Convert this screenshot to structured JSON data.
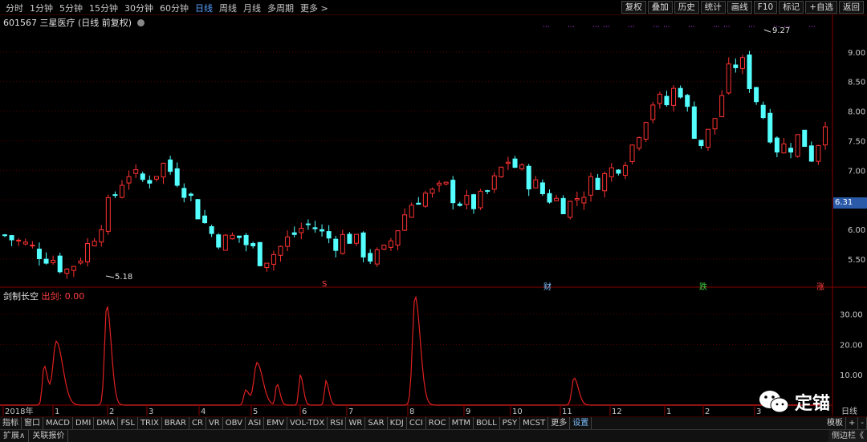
{
  "toolbar": {
    "periods": [
      "分时",
      "1分钟",
      "5分钟",
      "15分钟",
      "30分钟",
      "60分钟",
      "日线",
      "周线",
      "月线",
      "多周期",
      "更多 >"
    ],
    "active_period": "日线",
    "right_buttons": [
      "复权",
      "叠加",
      "历史",
      "统计",
      "画线",
      "F10",
      "标记",
      "+自选",
      "返回"
    ]
  },
  "stock": {
    "code_name": "601567 三星医疗 (日线 前复权)"
  },
  "price_axis": {
    "ticks": [
      "9.00",
      "8.50",
      "8.00",
      "7.50",
      "7.00",
      "6.50",
      "6.00",
      "5.50"
    ],
    "current": "6.31"
  },
  "annotations": {
    "high": "9.27",
    "low": "5.18"
  },
  "events": [
    "S",
    "财",
    "跌",
    "涨"
  ],
  "indicator": {
    "name": "剑制长空",
    "label": "出剑: 0.00",
    "ticks": [
      "30.00",
      "20.00",
      "10.00"
    ]
  },
  "time_axis": [
    "2018年",
    "1",
    "2",
    "3",
    "4",
    "5",
    "6",
    "7",
    "8",
    "9",
    "10",
    "11",
    "12",
    "1",
    "2",
    "3"
  ],
  "panel_label": "日线",
  "bottom_tabs": [
    "指标",
    "窗口",
    "MACD",
    "DMI",
    "DMA",
    "FSL",
    "TRIX",
    "BRAR",
    "CR",
    "VR",
    "OBV",
    "ASI",
    "EMV",
    "VOL-TDX",
    "RSI",
    "WR",
    "SAR",
    "KDJ",
    "CCI",
    "ROC",
    "MTM",
    "BOLL",
    "PSY",
    "MCST",
    "更多",
    "设置"
  ],
  "bottom_right": [
    "模板",
    "+",
    "-"
  ],
  "status_bar": {
    "left": [
      "扩展∧",
      "关联报价"
    ],
    "right": "侧边栏《"
  },
  "watermark": "定锚",
  "colors": {
    "up": "#ff3232",
    "down": "#54ffff",
    "grid": "#5a0000",
    "accent": "#5aa0ff"
  },
  "chart_data": {
    "type": "candlestick",
    "price_range": [
      5.18,
      9.27
    ],
    "closes": [
      5.9,
      5.8,
      5.7,
      5.6,
      5.5,
      5.3,
      5.5,
      5.8,
      6.2,
      6.6,
      7.0,
      6.8,
      6.9,
      7.1,
      6.9,
      6.6,
      6.2,
      5.9,
      5.8,
      5.9,
      5.7,
      5.5,
      5.6,
      5.8,
      6.0,
      6.1,
      5.9,
      5.8,
      5.9,
      5.7,
      5.5,
      5.6,
      6.0,
      6.4,
      6.6,
      6.6,
      6.7,
      6.5,
      6.4,
      6.5,
      6.8,
      7.2,
      7.0,
      6.8,
      6.6,
      6.5,
      6.4,
      6.6,
      6.8,
      6.9,
      7.1,
      7.3,
      7.8,
      8.2,
      8.1,
      8.5,
      7.8,
      7.4,
      7.9,
      8.6,
      8.9,
      8.4,
      7.9,
      7.4,
      7.4,
      7.6,
      7.2,
      7.9
    ]
  }
}
